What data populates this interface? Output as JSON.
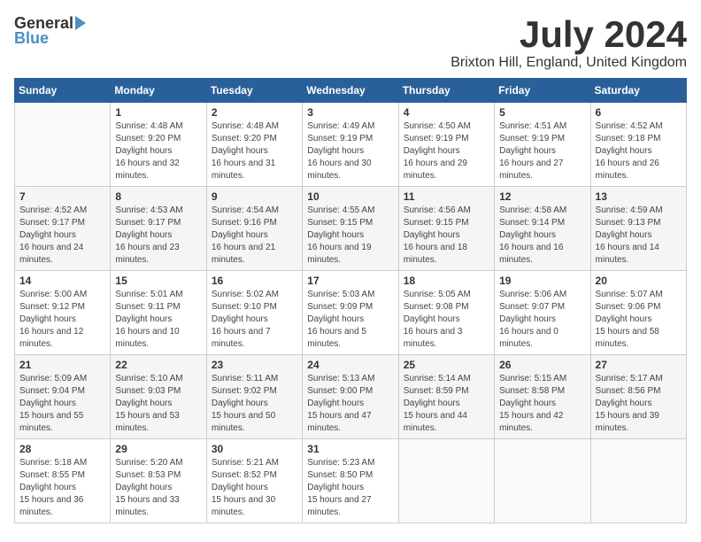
{
  "header": {
    "logo_general": "General",
    "logo_blue": "Blue",
    "month_title": "July 2024",
    "location": "Brixton Hill, England, United Kingdom"
  },
  "calendar": {
    "days_of_week": [
      "Sunday",
      "Monday",
      "Tuesday",
      "Wednesday",
      "Thursday",
      "Friday",
      "Saturday"
    ],
    "weeks": [
      [
        {
          "num": "",
          "empty": true
        },
        {
          "num": "1",
          "rise": "4:48 AM",
          "set": "9:20 PM",
          "daylight": "16 hours and 32 minutes."
        },
        {
          "num": "2",
          "rise": "4:48 AM",
          "set": "9:20 PM",
          "daylight": "16 hours and 31 minutes."
        },
        {
          "num": "3",
          "rise": "4:49 AM",
          "set": "9:19 PM",
          "daylight": "16 hours and 30 minutes."
        },
        {
          "num": "4",
          "rise": "4:50 AM",
          "set": "9:19 PM",
          "daylight": "16 hours and 29 minutes."
        },
        {
          "num": "5",
          "rise": "4:51 AM",
          "set": "9:19 PM",
          "daylight": "16 hours and 27 minutes."
        },
        {
          "num": "6",
          "rise": "4:52 AM",
          "set": "9:18 PM",
          "daylight": "16 hours and 26 minutes."
        }
      ],
      [
        {
          "num": "7",
          "rise": "4:52 AM",
          "set": "9:17 PM",
          "daylight": "16 hours and 24 minutes."
        },
        {
          "num": "8",
          "rise": "4:53 AM",
          "set": "9:17 PM",
          "daylight": "16 hours and 23 minutes."
        },
        {
          "num": "9",
          "rise": "4:54 AM",
          "set": "9:16 PM",
          "daylight": "16 hours and 21 minutes."
        },
        {
          "num": "10",
          "rise": "4:55 AM",
          "set": "9:15 PM",
          "daylight": "16 hours and 19 minutes."
        },
        {
          "num": "11",
          "rise": "4:56 AM",
          "set": "9:15 PM",
          "daylight": "16 hours and 18 minutes."
        },
        {
          "num": "12",
          "rise": "4:58 AM",
          "set": "9:14 PM",
          "daylight": "16 hours and 16 minutes."
        },
        {
          "num": "13",
          "rise": "4:59 AM",
          "set": "9:13 PM",
          "daylight": "16 hours and 14 minutes."
        }
      ],
      [
        {
          "num": "14",
          "rise": "5:00 AM",
          "set": "9:12 PM",
          "daylight": "16 hours and 12 minutes."
        },
        {
          "num": "15",
          "rise": "5:01 AM",
          "set": "9:11 PM",
          "daylight": "16 hours and 10 minutes."
        },
        {
          "num": "16",
          "rise": "5:02 AM",
          "set": "9:10 PM",
          "daylight": "16 hours and 7 minutes."
        },
        {
          "num": "17",
          "rise": "5:03 AM",
          "set": "9:09 PM",
          "daylight": "16 hours and 5 minutes."
        },
        {
          "num": "18",
          "rise": "5:05 AM",
          "set": "9:08 PM",
          "daylight": "16 hours and 3 minutes."
        },
        {
          "num": "19",
          "rise": "5:06 AM",
          "set": "9:07 PM",
          "daylight": "16 hours and 0 minutes."
        },
        {
          "num": "20",
          "rise": "5:07 AM",
          "set": "9:06 PM",
          "daylight": "15 hours and 58 minutes."
        }
      ],
      [
        {
          "num": "21",
          "rise": "5:09 AM",
          "set": "9:04 PM",
          "daylight": "15 hours and 55 minutes."
        },
        {
          "num": "22",
          "rise": "5:10 AM",
          "set": "9:03 PM",
          "daylight": "15 hours and 53 minutes."
        },
        {
          "num": "23",
          "rise": "5:11 AM",
          "set": "9:02 PM",
          "daylight": "15 hours and 50 minutes."
        },
        {
          "num": "24",
          "rise": "5:13 AM",
          "set": "9:00 PM",
          "daylight": "15 hours and 47 minutes."
        },
        {
          "num": "25",
          "rise": "5:14 AM",
          "set": "8:59 PM",
          "daylight": "15 hours and 44 minutes."
        },
        {
          "num": "26",
          "rise": "5:15 AM",
          "set": "8:58 PM",
          "daylight": "15 hours and 42 minutes."
        },
        {
          "num": "27",
          "rise": "5:17 AM",
          "set": "8:56 PM",
          "daylight": "15 hours and 39 minutes."
        }
      ],
      [
        {
          "num": "28",
          "rise": "5:18 AM",
          "set": "8:55 PM",
          "daylight": "15 hours and 36 minutes."
        },
        {
          "num": "29",
          "rise": "5:20 AM",
          "set": "8:53 PM",
          "daylight": "15 hours and 33 minutes."
        },
        {
          "num": "30",
          "rise": "5:21 AM",
          "set": "8:52 PM",
          "daylight": "15 hours and 30 minutes."
        },
        {
          "num": "31",
          "rise": "5:23 AM",
          "set": "8:50 PM",
          "daylight": "15 hours and 27 minutes."
        },
        {
          "num": "",
          "empty": true
        },
        {
          "num": "",
          "empty": true
        },
        {
          "num": "",
          "empty": true
        }
      ]
    ]
  }
}
